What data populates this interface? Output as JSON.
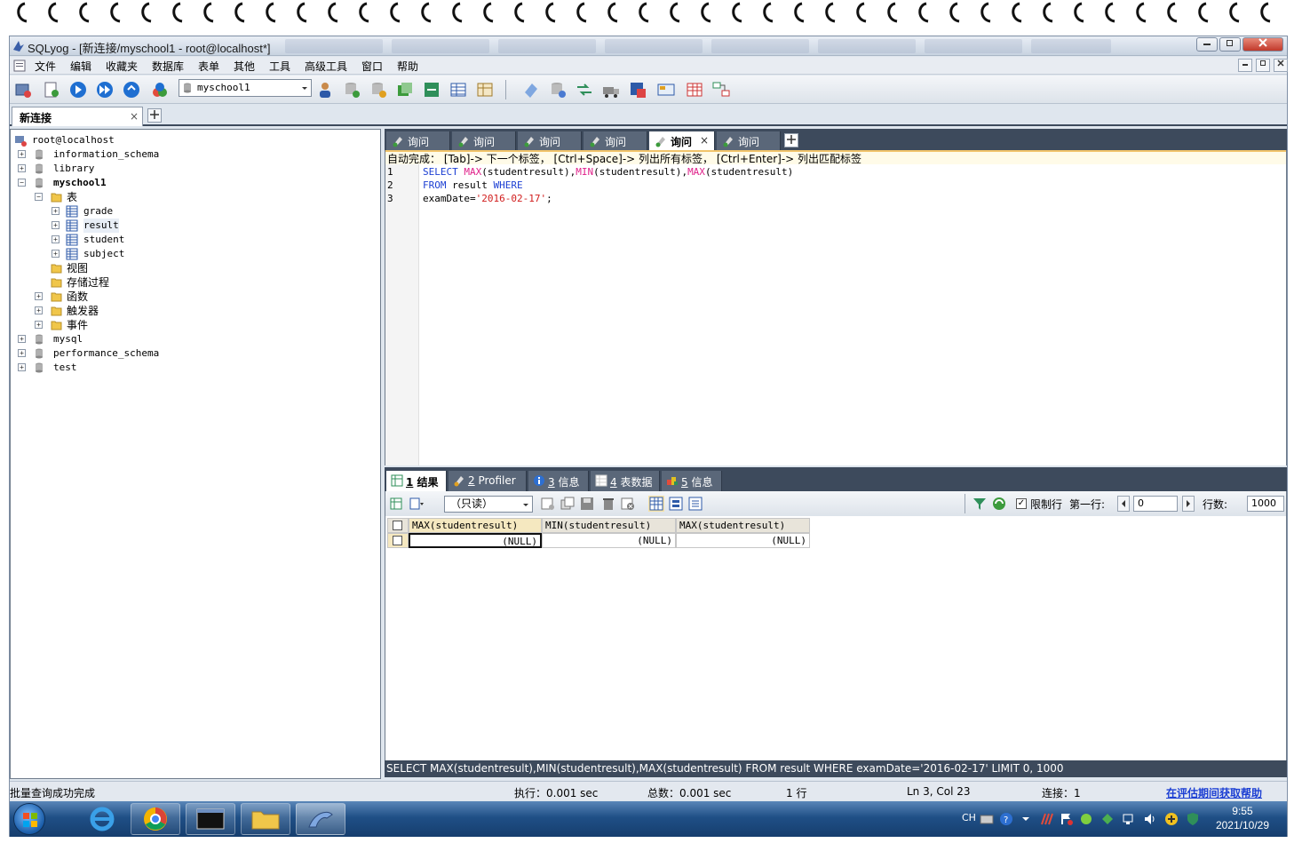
{
  "window": {
    "title": "SQLyog - [新连接/myschool1 - root@localhost*]"
  },
  "menu": [
    "文件",
    "编辑",
    "收藏夹",
    "数据库",
    "表单",
    "其他",
    "工具",
    "高级工具",
    "窗口",
    "帮助"
  ],
  "toolbar": {
    "database_selected": "myschool1"
  },
  "connection_tab": {
    "label": "新连接",
    "close": "×"
  },
  "tree": {
    "root": "root@localhost",
    "dbs": {
      "information_schema": "information_schema",
      "library": "library",
      "myschool1": "myschool1",
      "mysql": "mysql",
      "performance_schema": "performance_schema",
      "test": "test"
    },
    "folders": {
      "tables": "表",
      "views": "视图",
      "procs": "存储过程",
      "functions": "函数",
      "triggers": "触发器",
      "events": "事件"
    },
    "tables": [
      "grade",
      "result",
      "student",
      "subject"
    ],
    "expander_plus": "+",
    "expander_minus": "−"
  },
  "query_tabs": [
    "询问",
    "询问",
    "询问",
    "询问",
    "询问",
    "询问"
  ],
  "query_tab_close": "×",
  "autocomplete_hint": "自动完成： [Tab]-> 下一个标签， [Ctrl+Space]-> 列出所有标签， [Ctrl+Enter]-> 列出匹配标签",
  "editor": {
    "line_numbers": [
      "1",
      "2",
      "3"
    ],
    "tokens": {
      "select": "SELECT",
      "max": "MAX",
      "min": "MIN",
      "arg": "(studentresult)",
      "comma": ",",
      "from": "FROM",
      "table": " result ",
      "where": "WHERE",
      "cond": "examDate=",
      "date": "'2016-02-17'",
      "semi": ";"
    }
  },
  "result_tabs": [
    {
      "num": "1",
      "label": " 结果"
    },
    {
      "num": "2",
      "label": " Profiler"
    },
    {
      "num": "3",
      "label": " 信息"
    },
    {
      "num": "4",
      "label": " 表数据"
    },
    {
      "num": "5",
      "label": " 信息"
    }
  ],
  "result_toolbar": {
    "readonly": "（只读）",
    "limit_rows_label": "限制行",
    "limit_checked": "✓",
    "first_row_label": "第一行:",
    "first_row_value": "0",
    "row_count_label": "行数:",
    "row_count_value": "1000"
  },
  "grid": {
    "columns": [
      "MAX(studentresult)",
      "MIN(studentresult)",
      "MAX(studentresult)"
    ],
    "row": [
      "(NULL)",
      "(NULL)",
      "(NULL)"
    ]
  },
  "sql_status": "SELECT MAX(studentresult),MIN(studentresult),MAX(studentresult) FROM result WHERE examDate='2016-02-17' LIMIT 0, 1000",
  "status": {
    "message": "批量查询成功完成",
    "exec": "执行：0.001 sec",
    "total": "总数：0.001 sec",
    "rows": "1 行",
    "cursor": "Ln 3, Col 23",
    "connections": "连接：1",
    "help": "在评估期间获取帮助"
  },
  "taskbar": {
    "ime": "CH",
    "time": "9:55",
    "date": "2021/10/29"
  },
  "colors": {
    "dark_tab_bg": "#3d4a5c",
    "keyword": "#1c3fd3",
    "function": "#e0218a",
    "string": "#d11d1d"
  }
}
